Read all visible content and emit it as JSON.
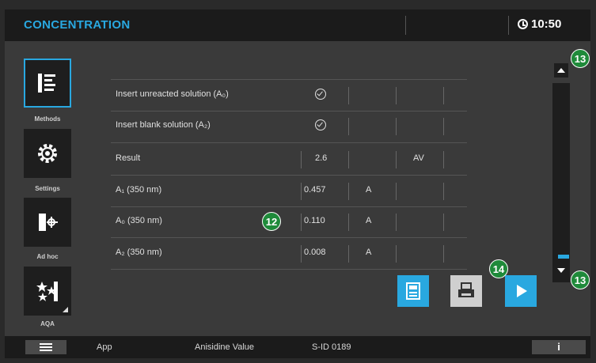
{
  "header": {
    "title": "CONCENTRATION",
    "time": "10:50"
  },
  "sidebar": {
    "items": [
      {
        "label": "Methods",
        "icon": "methods-icon",
        "active": true
      },
      {
        "label": "Settings",
        "icon": "gear-icon",
        "active": false
      },
      {
        "label": "Ad hoc",
        "icon": "adhoc-icon",
        "active": false
      },
      {
        "label": "AQA",
        "icon": "aqa-icon",
        "active": false
      }
    ]
  },
  "table": {
    "rows": [
      {
        "label": "Insert unreacted solution (A₀)",
        "check": true
      },
      {
        "label": "Insert blank solution (A₂)",
        "check": true
      },
      {
        "label": "Result",
        "value": "2.6",
        "unit2": "AV"
      },
      {
        "label": "A₁ (350 nm)",
        "value": "0.457",
        "unit": "A"
      },
      {
        "label": "A₀ (350 nm)",
        "value": "0.110",
        "unit": "A"
      },
      {
        "label": "A₂ (350 nm)",
        "value": "0.008",
        "unit": "A"
      }
    ]
  },
  "callouts": {
    "table": "12",
    "scroll_up": "13",
    "scroll_down": "13",
    "print": "14"
  },
  "footer": {
    "app_label": "App",
    "method": "Anisidine Value",
    "id": "S-ID 0189",
    "info": "i"
  },
  "colors": {
    "accent": "#29a8e0",
    "callout": "#1f8a3a"
  }
}
